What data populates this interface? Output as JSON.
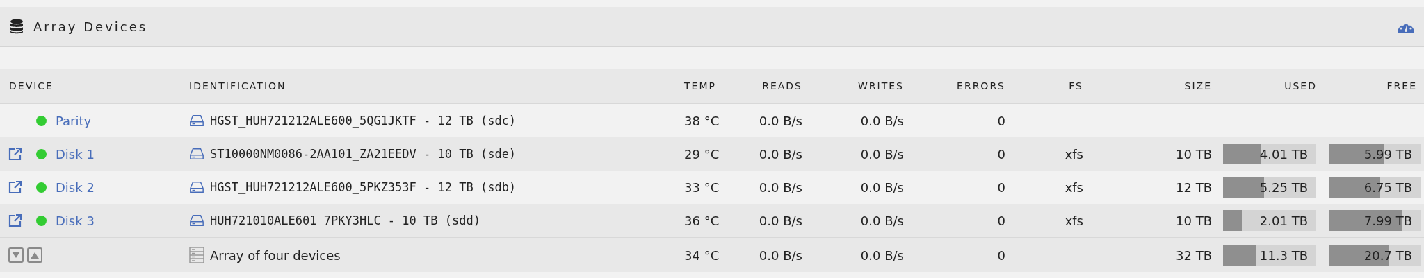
{
  "panel": {
    "title": "Array Devices"
  },
  "table": {
    "columns": [
      "DEVICE",
      "IDENTIFICATION",
      "TEMP",
      "READS",
      "WRITES",
      "ERRORS",
      "FS",
      "SIZE",
      "USED",
      "FREE"
    ],
    "rows": [
      {
        "kind": "parity",
        "device": "Parity",
        "color": "#33cc33",
        "identification": "HGST_HUH721212ALE600_5QG1JKTF - 12 TB (sdc)",
        "temp": "38 °C",
        "reads": "0.0 B/s",
        "writes": "0.0 B/s",
        "errors": "0"
      },
      {
        "kind": "disk",
        "device": "Disk 1",
        "color": "#33cc33",
        "identification": "ST10000NM0086-2AA101_ZA21EEDV - 10 TB (sde)",
        "temp": "29 °C",
        "reads": "0.0 B/s",
        "writes": "0.0 B/s",
        "errors": "0",
        "fs": "xfs",
        "size": "10 TB",
        "used": {
          "text": "4.01 TB",
          "level": 0.4
        },
        "free": {
          "text": "5.99 TB",
          "level": 0.6
        }
      },
      {
        "kind": "disk",
        "device": "Disk 2",
        "color": "#33cc33",
        "identification": "HGST_HUH721212ALE600_5PKZ353F - 12 TB (sdb)",
        "temp": "33 °C",
        "reads": "0.0 B/s",
        "writes": "0.0 B/s",
        "errors": "0",
        "fs": "xfs",
        "size": "12 TB",
        "used": {
          "text": "5.25 TB",
          "level": 0.44
        },
        "free": {
          "text": "6.75 TB",
          "level": 0.56
        }
      },
      {
        "kind": "disk",
        "device": "Disk 3",
        "color": "#33cc33",
        "identification": "HUH721010ALE601_7PKY3HLC - 10 TB (sdd)",
        "temp": "36 °C",
        "reads": "0.0 B/s",
        "writes": "0.0 B/s",
        "errors": "0",
        "fs": "xfs",
        "size": "10 TB",
        "used": {
          "text": "2.01 TB",
          "level": 0.2
        },
        "free": {
          "text": "7.99 TB",
          "level": 0.8
        }
      },
      {
        "kind": "total",
        "identification": "Array of four devices",
        "temp": "34 °C",
        "reads": "0.0 B/s",
        "writes": "0.0 B/s",
        "errors": "0",
        "size": "32 TB",
        "used": {
          "text": "11.3 TB",
          "level": 0.35
        },
        "free": {
          "text": "20.7 TB",
          "level": 0.65
        }
      }
    ]
  }
}
